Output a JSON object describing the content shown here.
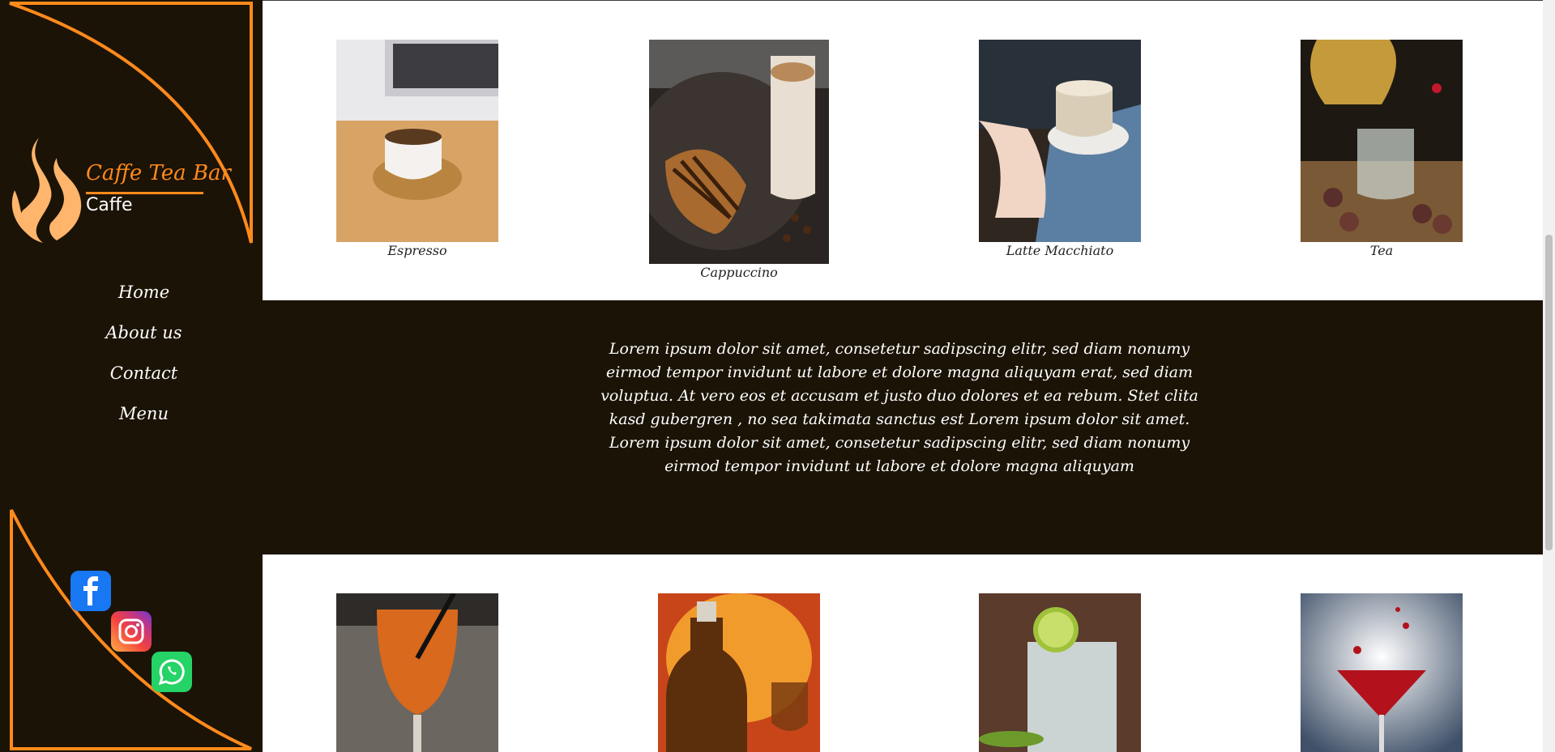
{
  "brand": {
    "name": "Caffe Tea Bar",
    "subtitle": "Caffe"
  },
  "nav": [
    "Home",
    "About us",
    "Contact",
    "Menu"
  ],
  "social": [
    "facebook-icon",
    "instagram-icon",
    "whatsapp-icon"
  ],
  "products_top": [
    {
      "caption": "Espresso"
    },
    {
      "caption": "Cappuccino"
    },
    {
      "caption": "Latte Macchiato"
    },
    {
      "caption": "Tea"
    }
  ],
  "band_text": "Lorem ipsum dolor sit amet, consetetur sadipscing elitr, sed diam nonumy eirmod tempor invidunt ut labore et dolore magna aliquyam erat, sed diam voluptua. At vero eos et accusam et justo duo dolores et ea rebum. Stet clita kasd gubergren , no sea takimata sanctus est Lorem ipsum dolor sit amet. Lorem ipsum dolor sit amet, consetetur sadipscing elitr, sed diam nonumy eirmod tempor invidunt ut labore et dolore magna aliquyam",
  "colors": {
    "sidebar_bg": "#1b1306",
    "accent": "#ff8a1c",
    "logo_flame": "#ffb56b"
  }
}
